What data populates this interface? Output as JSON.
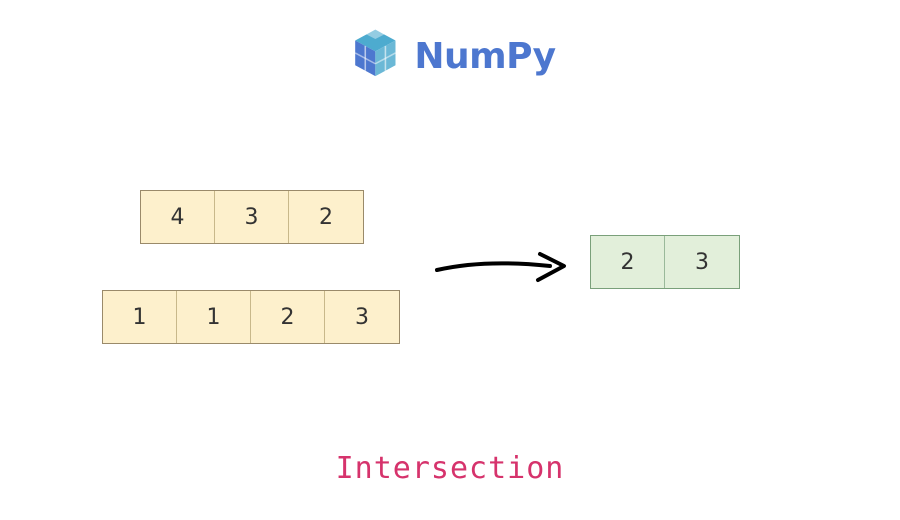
{
  "logo": {
    "text": "NumPy"
  },
  "arrays": {
    "a": [
      "4",
      "3",
      "2"
    ],
    "b": [
      "1",
      "1",
      "2",
      "3"
    ],
    "result": [
      "2",
      "3"
    ]
  },
  "caption": "Intersection",
  "colors": {
    "brand": "#4d77cf",
    "accent": "#4dabcf",
    "input_fill": "#fdf0cc",
    "output_fill": "#e2efda",
    "caption": "#d6336c"
  }
}
